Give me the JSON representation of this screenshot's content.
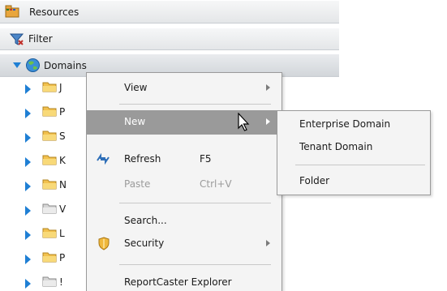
{
  "tree": {
    "resources_label": "Resources",
    "filter_label": "Filter",
    "domains_label": "Domains",
    "children": [
      {
        "letter": "J",
        "folder": "folder-yellow"
      },
      {
        "letter": "P",
        "folder": "folder-yellow"
      },
      {
        "letter": "S",
        "folder": "folder-yellow"
      },
      {
        "letter": "K",
        "folder": "folder-yellow"
      },
      {
        "letter": "N",
        "folder": "folder-yellow"
      },
      {
        "letter": "V",
        "folder": "folder-gray"
      },
      {
        "letter": "L",
        "folder": "folder-yellow"
      },
      {
        "letter": "P",
        "folder": "folder-yellow"
      },
      {
        "letter": "!",
        "folder": "folder-gray"
      }
    ]
  },
  "context_menu": {
    "view": "View",
    "new": "New",
    "refresh": "Refresh",
    "refresh_shortcut": "F5",
    "paste": "Paste",
    "paste_shortcut": "Ctrl+V",
    "search": "Search...",
    "security": "Security",
    "reportcaster": "ReportCaster Explorer"
  },
  "submenu": {
    "enterprise_domain": "Enterprise Domain",
    "tenant_domain": "Tenant Domain",
    "folder": "Folder"
  },
  "colors": {
    "highlight": "#9a9a9a",
    "tree_arrow": "#1f7fd4",
    "folder_yellow": "#f2c14e"
  }
}
